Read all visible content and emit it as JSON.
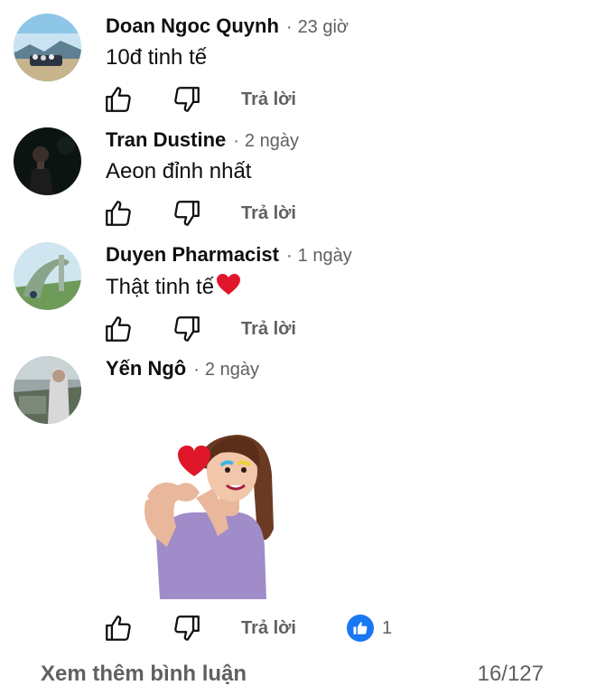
{
  "comments": [
    {
      "author": "Doan Ngoc Quynh",
      "separator": "·",
      "time": "23 giờ",
      "text": "10đ tinh tế",
      "reply_label": "Trả lời"
    },
    {
      "author": "Tran Dustine",
      "separator": "·",
      "time": "2 ngày",
      "text": "Aeon đỉnh nhất",
      "reply_label": "Trả lời"
    },
    {
      "author": "Duyen Pharmacist",
      "separator": "·",
      "time": "1 ngày",
      "text": "Thật tinh tế",
      "text_emoji": "red-heart-icon",
      "reply_label": "Trả lời"
    },
    {
      "author": "Yến Ngô",
      "separator": "·",
      "time": "2 ngày",
      "attachment": "avatar-heart-sticker",
      "reply_label": "Trả lời",
      "like_count": "1"
    }
  ],
  "footer": {
    "more_comments_label": "Xem thêm bình luận",
    "count": "16/127"
  },
  "colors": {
    "author_text": "#0f0f0f",
    "secondary_text": "#606060",
    "reaction_blue": "#1877f2",
    "heart_red": "#e0162b"
  }
}
